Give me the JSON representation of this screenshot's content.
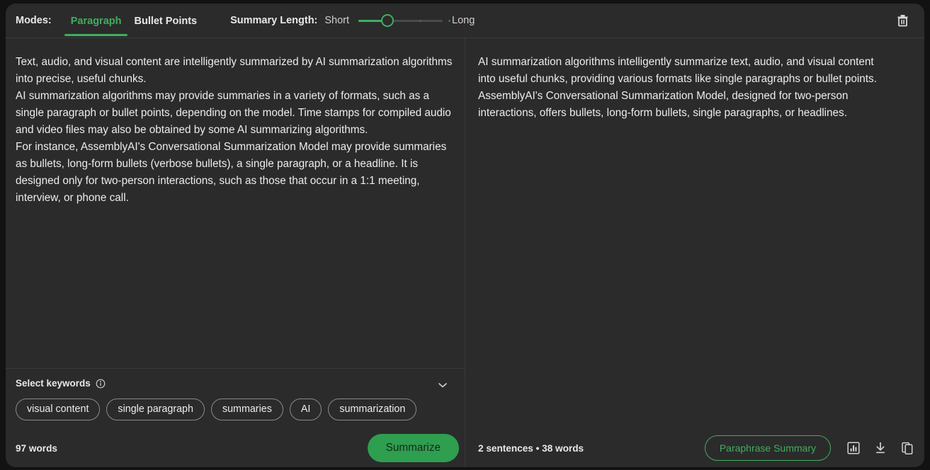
{
  "toolbar": {
    "modes_label": "Modes:",
    "modes": [
      {
        "label": "Paragraph",
        "active": true
      },
      {
        "label": "Bullet Points",
        "active": false
      }
    ],
    "summary_length_label": "Summary Length:",
    "length_short": "Short",
    "length_long": "Long",
    "delete_icon": "trash-icon",
    "slider_value_fraction": 0.3,
    "accent_color": "#3fae5f"
  },
  "left_pane": {
    "input_text": "Text, audio, and visual content are intelligently summarized by AI summarization algorithms into precise, useful chunks.\nAI summarization algorithms may provide summaries in a variety of formats, such as a single paragraph or bullet points, depending on the model. Time stamps for compiled audio and video files may also be obtained by some AI summarizing algorithms.\nFor instance, AssemblyAI's Conversational Summarization Model may provide summaries as bullets, long-form bullets (verbose bullets), a single paragraph, or a headline. It is designed only for two-person interactions, such as those that occur in a 1:1 meeting, interview, or phone call.",
    "keywords_title": "Select keywords",
    "keywords_info_icon": "info-icon",
    "keywords_collapse_icon": "chevron-down-icon",
    "keywords": [
      "visual content",
      "single paragraph",
      "summaries",
      "AI",
      "summarization"
    ],
    "word_count": "97 words",
    "summarize_label": "Summarize"
  },
  "right_pane": {
    "summary_text": "AI summarization algorithms intelligently summarize text, audio, and visual content into useful chunks, providing various formats like single paragraphs or bullet points. AssemblyAI's Conversational Summarization Model, designed for two-person interactions, offers bullets, long-form bullets, single paragraphs, or headlines.",
    "stats": "2 sentences  •  38 words",
    "paraphrase_label": "Paraphrase Summary",
    "icons": [
      "bar-chart-icon",
      "download-icon",
      "copy-icon"
    ]
  }
}
